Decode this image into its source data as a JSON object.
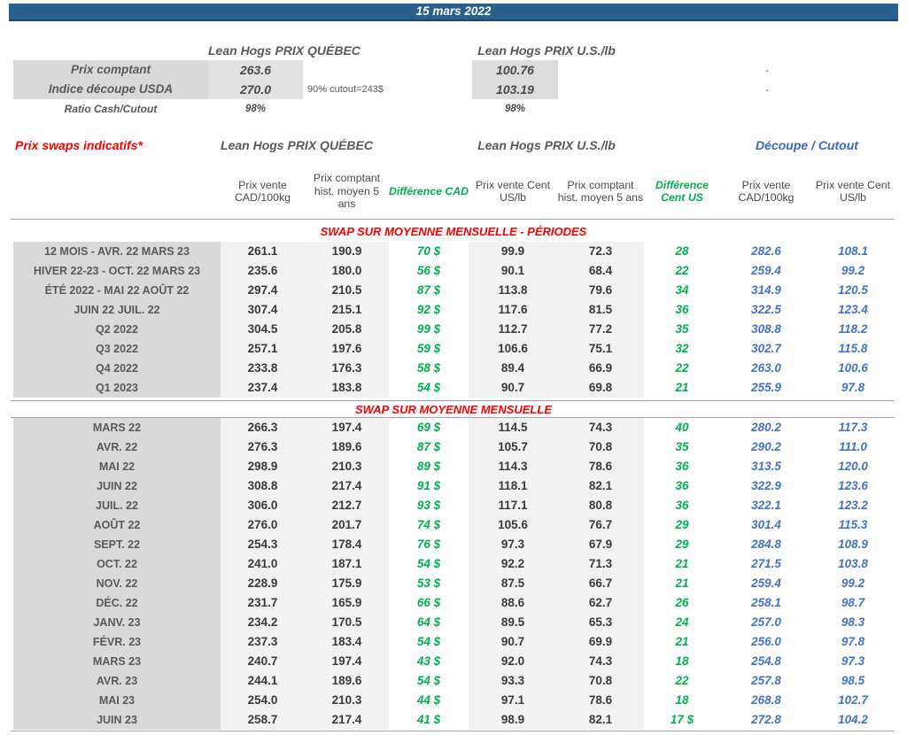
{
  "title_bar": {
    "date": "15 mars 2022"
  },
  "top": {
    "quebec_header": "Lean Hogs PRIX QUÉBEC",
    "us_header": "Lean Hogs PRIX U.S./lb",
    "rows": [
      {
        "label": "Prix comptant",
        "qc": "263.6",
        "note": "",
        "us": "100.76",
        "right": "-"
      },
      {
        "label": "Indice découpe USDA",
        "qc": "270.0",
        "note": "90% cutout=243$",
        "us": "103.19",
        "right": "-"
      },
      {
        "label": "Ratio Cash/Cutout",
        "qc": "98%",
        "note": "",
        "us": "98%",
        "right": ""
      }
    ]
  },
  "swaps": {
    "title": "Prix swaps indicatifs*",
    "quebec_header": "Lean Hogs PRIX QUÉBEC",
    "us_header": "Lean Hogs PRIX U.S./lb",
    "cutout_header": "Découpe / Cutout",
    "columns": [
      "Prix vente CAD/100kg",
      "Prix comptant hist. moyen 5 ans",
      "Différence CAD",
      "Prix vente Cent US/lb",
      "Prix comptant hist. moyen 5 ans",
      "Différence Cent US",
      "Prix vente CAD/100kg",
      "Prix vente Cent US/lb"
    ]
  },
  "colors": {
    "bar_blue": "#2B5F8E",
    "accent_red": "#FA0000",
    "accent_green": "#00B050",
    "accent_blue": "#4472C4",
    "label_gray_bg": "#D9D9D9",
    "data_gray_bg": "#F2F2F2"
  },
  "sections": [
    {
      "title": "SWAP SUR MOYENNE MENSUELLE - PÉRIODES",
      "rows": [
        {
          "label": "12 MOIS - AVR. 22 MARS 23",
          "c1": "261.1",
          "c2": "190.9",
          "d1": "70 $",
          "c3": "99.9",
          "c4": "72.3",
          "d2": "28",
          "c5": "282.6",
          "c6": "108.1"
        },
        {
          "label": "HIVER 22-23 - OCT. 22 MARS 23",
          "c1": "235.6",
          "c2": "180.0",
          "d1": "56 $",
          "c3": "90.1",
          "c4": "68.4",
          "d2": "22",
          "c5": "259.4",
          "c6": "99.2"
        },
        {
          "label": "ÉTÉ 2022 - MAI 22 AOÛT 22",
          "c1": "297.4",
          "c2": "210.5",
          "d1": "87 $",
          "c3": "113.8",
          "c4": "79.6",
          "d2": "34",
          "c5": "314.9",
          "c6": "120.5"
        },
        {
          "label": "JUIN 22 JUIL. 22",
          "c1": "307.4",
          "c2": "215.1",
          "d1": "92 $",
          "c3": "117.6",
          "c4": "81.5",
          "d2": "36",
          "c5": "322.5",
          "c6": "123.4"
        },
        {
          "label": "Q2 2022",
          "c1": "304.5",
          "c2": "205.8",
          "d1": "99 $",
          "c3": "112.7",
          "c4": "77.2",
          "d2": "35",
          "c5": "308.8",
          "c6": "118.2"
        },
        {
          "label": "Q3 2022",
          "c1": "257.1",
          "c2": "197.6",
          "d1": "59 $",
          "c3": "106.6",
          "c4": "75.1",
          "d2": "32",
          "c5": "302.7",
          "c6": "115.8"
        },
        {
          "label": "Q4 2022",
          "c1": "233.8",
          "c2": "176.3",
          "d1": "58 $",
          "c3": "89.4",
          "c4": "66.9",
          "d2": "22",
          "c5": "263.0",
          "c6": "100.6"
        },
        {
          "label": "Q1 2023",
          "c1": "237.4",
          "c2": "183.8",
          "d1": "54 $",
          "c3": "90.7",
          "c4": "69.8",
          "d2": "21",
          "c5": "255.9",
          "c6": "97.8"
        }
      ]
    },
    {
      "title": "SWAP SUR MOYENNE MENSUELLE",
      "rows": [
        {
          "label": "MARS 22",
          "c1": "266.3",
          "c2": "197.4",
          "d1": "69 $",
          "c3": "114.5",
          "c4": "74.3",
          "d2": "40",
          "c5": "280.2",
          "c6": "117.3"
        },
        {
          "label": "AVR. 22",
          "c1": "276.3",
          "c2": "189.6",
          "d1": "87 $",
          "c3": "105.7",
          "c4": "70.8",
          "d2": "35",
          "c5": "290.2",
          "c6": "111.0"
        },
        {
          "label": "MAI 22",
          "c1": "298.9",
          "c2": "210.3",
          "d1": "89 $",
          "c3": "114.3",
          "c4": "78.6",
          "d2": "36",
          "c5": "313.5",
          "c6": "120.0"
        },
        {
          "label": "JUIN 22",
          "c1": "308.8",
          "c2": "217.4",
          "d1": "91 $",
          "c3": "118.1",
          "c4": "82.1",
          "d2": "36",
          "c5": "322.9",
          "c6": "123.6"
        },
        {
          "label": "JUIL. 22",
          "c1": "306.0",
          "c2": "212.7",
          "d1": "93 $",
          "c3": "117.1",
          "c4": "80.8",
          "d2": "36",
          "c5": "322.1",
          "c6": "123.2"
        },
        {
          "label": "AOÛT 22",
          "c1": "276.0",
          "c2": "201.7",
          "d1": "74 $",
          "c3": "105.6",
          "c4": "76.7",
          "d2": "29",
          "c5": "301.4",
          "c6": "115.3"
        },
        {
          "label": "SEPT. 22",
          "c1": "254.3",
          "c2": "178.4",
          "d1": "76 $",
          "c3": "97.3",
          "c4": "67.9",
          "d2": "29",
          "c5": "284.8",
          "c6": "108.9"
        },
        {
          "label": "OCT. 22",
          "c1": "241.0",
          "c2": "187.1",
          "d1": "54 $",
          "c3": "92.2",
          "c4": "71.3",
          "d2": "21",
          "c5": "271.5",
          "c6": "103.8"
        },
        {
          "label": "NOV. 22",
          "c1": "228.9",
          "c2": "175.9",
          "d1": "53 $",
          "c3": "87.5",
          "c4": "66.7",
          "d2": "21",
          "c5": "259.4",
          "c6": "99.2"
        },
        {
          "label": "DÉC. 22",
          "c1": "231.7",
          "c2": "165.9",
          "d1": "66 $",
          "c3": "88.6",
          "c4": "62.7",
          "d2": "26",
          "c5": "258.1",
          "c6": "98.7"
        },
        {
          "label": "JANV. 23",
          "c1": "234.2",
          "c2": "170.5",
          "d1": "64 $",
          "c3": "89.5",
          "c4": "65.3",
          "d2": "24",
          "c5": "257.0",
          "c6": "98.3"
        },
        {
          "label": "FÉVR. 23",
          "c1": "237.3",
          "c2": "183.4",
          "d1": "54 $",
          "c3": "90.7",
          "c4": "69.9",
          "d2": "21",
          "c5": "256.0",
          "c6": "97.8"
        },
        {
          "label": "MARS 23",
          "c1": "240.7",
          "c2": "197.4",
          "d1": "43 $",
          "c3": "92.0",
          "c4": "74.3",
          "d2": "18",
          "c5": "254.8",
          "c6": "97.3"
        },
        {
          "label": "AVR. 23",
          "c1": "244.1",
          "c2": "189.6",
          "d1": "54 $",
          "c3": "93.3",
          "c4": "70.8",
          "d2": "22",
          "c5": "257.8",
          "c6": "98.5"
        },
        {
          "label": "MAI 23",
          "c1": "254.0",
          "c2": "210.3",
          "d1": "44 $",
          "c3": "97.1",
          "c4": "78.6",
          "d2": "18",
          "c5": "268.8",
          "c6": "102.7"
        },
        {
          "label": "JUIN 23",
          "c1": "258.7",
          "c2": "217.4",
          "d1": "41 $",
          "c3": "98.9",
          "c4": "82.1",
          "d2": "17 $",
          "c5": "272.8",
          "c6": "104.2"
        }
      ]
    }
  ]
}
